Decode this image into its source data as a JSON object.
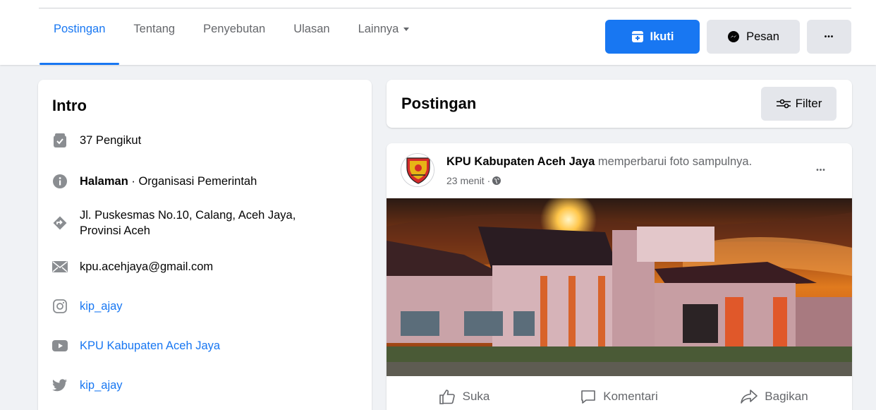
{
  "nav": {
    "tabs": [
      {
        "label": "Postingan"
      },
      {
        "label": "Tentang"
      },
      {
        "label": "Penyebutan"
      },
      {
        "label": "Ulasan"
      },
      {
        "label": "Lainnya"
      }
    ],
    "follow_label": "Ikuti",
    "message_label": "Pesan",
    "more_label": "•••"
  },
  "intro": {
    "title": "Intro",
    "followers": "37 Pengikut",
    "page_label": "Halaman",
    "page_category": " · Organisasi Pemerintah",
    "address_line1": "Jl. Puskesmas No.10, Calang, Aceh Jaya,",
    "address_line2": "Provinsi Aceh",
    "email": "kpu.acehjaya@gmail.com",
    "instagram": "kip_ajay",
    "youtube": "KPU Kabupaten Aceh Jaya",
    "twitter": "kip_ajay"
  },
  "posts": {
    "title": "Postingan",
    "filter_label": "Filter"
  },
  "post": {
    "author": "KPU Kabupaten Aceh Jaya",
    "action_text": " memperbarui foto sampulnya.",
    "time": "23 menit · ",
    "dots": "•••",
    "like_label": "Suka",
    "comment_label": "Komentari",
    "share_label": "Bagikan"
  },
  "colors": {
    "accent": "#1877f2",
    "muted": "#65676b",
    "background": "#f0f2f5",
    "button_grey": "#e4e6eb"
  },
  "icons": [
    "follow-icon",
    "messenger-icon",
    "followers-icon",
    "info-icon",
    "location-icon",
    "email-icon",
    "instagram-icon",
    "youtube-icon",
    "twitter-icon",
    "filter-icon",
    "globe-icon",
    "like-icon",
    "comment-icon",
    "share-icon"
  ]
}
